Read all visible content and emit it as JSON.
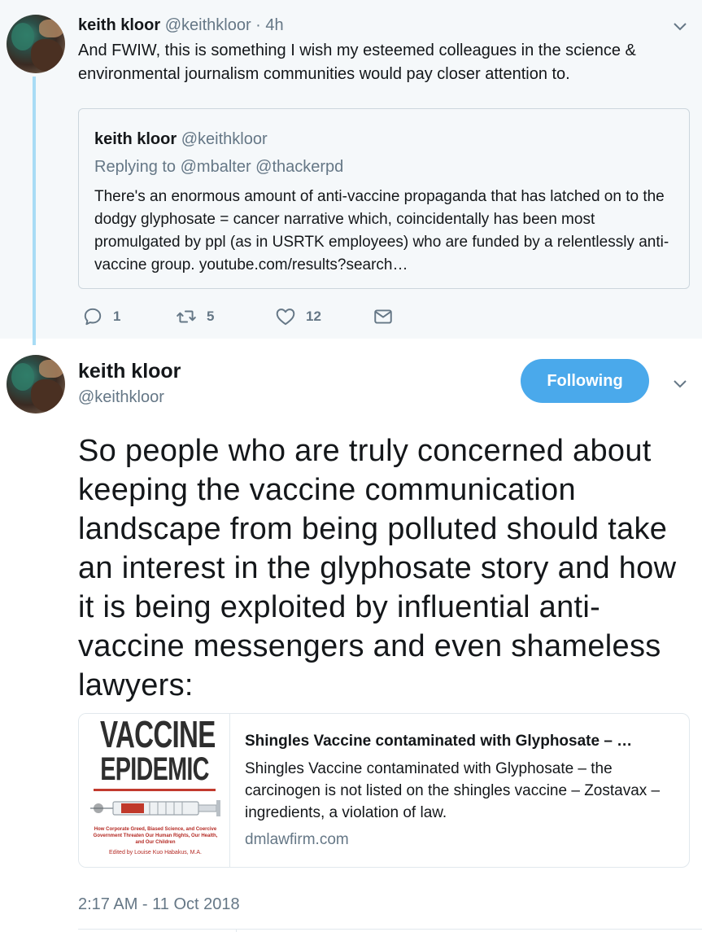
{
  "tweet1": {
    "name": "keith kloor",
    "handle": "@keithkloor",
    "separator": "·",
    "time": "4h",
    "text": "And FWIW, this is something I wish my esteemed colleagues in the science & environmental journalism communities would pay closer attention to.",
    "quote": {
      "name": "keith kloor",
      "handle": "@keithkloor",
      "replying_to": "Replying to @mbalter @thackerpd",
      "text": "There's an enormous amount of anti-vaccine propaganda that has latched on to the dodgy glyphosate = cancer narrative which, coincidentally has been most promulgated by ppl (as in USRTK employees) who are funded by a relentlessly anti-vaccine group. youtube.com/results?search…"
    },
    "actions": {
      "replies": "1",
      "retweets": "5",
      "likes": "12"
    }
  },
  "tweet2": {
    "name": "keith kloor",
    "handle": "@keithkloor",
    "follow_label": "Following",
    "text": "So people who are truly concerned about keeping the vaccine communication landscape from being polluted should take an interest in the glyphosate story and how it is being exploited by influential anti-vaccine messengers and even shameless lawyers:",
    "card": {
      "image": {
        "title_line1": "VACCINE",
        "title_line2": "EPIDEMIC",
        "subtitle": "How Corporate Greed, Biased Science, and Coercive Government Threaten Our Human Rights, Our Health, and Our Children",
        "author": "Edited by Louise Kuo Habakus, M.A."
      },
      "title": "Shingles Vaccine contaminated with Glyphosate – …",
      "description": "Shingles Vaccine contaminated with Glyphosate – the carcinogen is not listed on the shingles vaccine – Zostavax – ingredients, a violation of law.",
      "domain": "dmlawfirm.com"
    },
    "timestamp": "2:17 AM - 11 Oct 2018"
  },
  "icons": [
    "reply-icon",
    "retweet-icon",
    "like-icon",
    "direct-message-icon",
    "chevron-down-icon"
  ],
  "colors": {
    "top_background": "#f5f8fa",
    "thread_line": "#a8dcf5",
    "follow_button": "#4aa9eb",
    "secondary_text": "#657786"
  }
}
